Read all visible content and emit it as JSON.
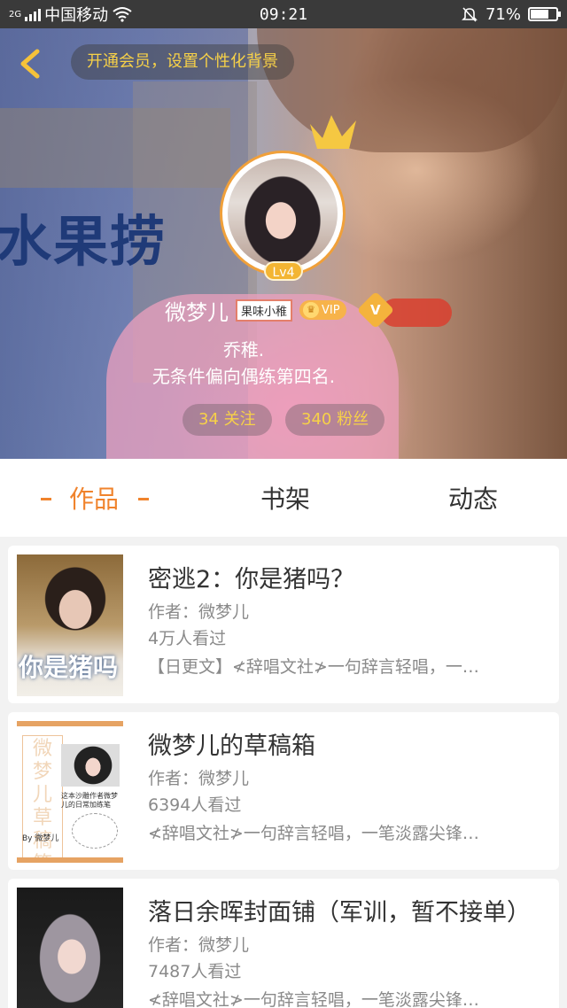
{
  "status_bar": {
    "network_type": "2G",
    "carrier": "中国移动",
    "time": "09:21",
    "battery": "71%",
    "battery_level": 0.71
  },
  "header": {
    "vip_banner": "开通会员，设置个性化背景",
    "background_text": "水果捞",
    "level": "Lv4",
    "user_name": "微梦儿",
    "name_tag": "果味小稚",
    "vip_label": "VIP",
    "v_label": "V",
    "bio_line1": "乔稚.",
    "bio_line2": "无条件偏向偶练第四名.",
    "following": "34 关注",
    "followers": "340 粉丝"
  },
  "tabs": {
    "works": "作品",
    "bookshelf": "书架",
    "activity": "动态"
  },
  "books": [
    {
      "title": "密逃2：你是猪吗？",
      "author": "作者：微梦儿",
      "views": "4万人看过",
      "desc": "【日更文】≮辞唱文社≯一句辞言轻唱，一…",
      "cover_text": "你是猪吗"
    },
    {
      "title": "微梦儿的草稿箱",
      "author": "作者：微梦儿",
      "views": "6394人看过",
      "desc": "≮辞唱文社≯一句辞言轻唱，一笔淡露尖锋…",
      "cover_text": "微梦儿草稿箱",
      "cover_small": "这本沙雕作者微梦儿的日常加练笔",
      "cover_by": "By 微梦儿"
    },
    {
      "title": "落日余晖封面铺（军训，暂不接单）",
      "author": "作者：微梦儿",
      "views": "7487人看过",
      "desc": "≮辞唱文社≯一句辞言轻唱，一笔淡露尖锋…"
    }
  ],
  "colors": {
    "accent": "#f0832c",
    "gold": "#f7d148",
    "status_bar_bg": "#3a3a3a"
  }
}
